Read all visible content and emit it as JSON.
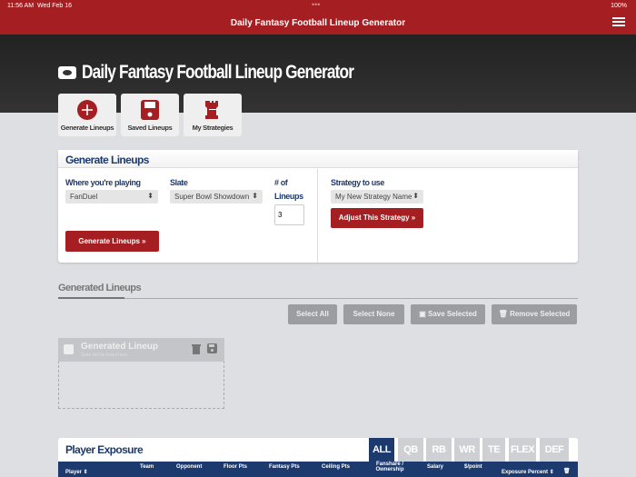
{
  "status": {
    "time": "11:56 AM",
    "date": "Wed Feb 16",
    "battery": "100%"
  },
  "app_title": "Daily Fantasy Football Lineup Generator",
  "hero_title": "Daily Fantasy Football Lineup Generator",
  "nav": [
    {
      "label": "Generate Lineups"
    },
    {
      "label": "Saved Lineups"
    },
    {
      "label": "My Strategies"
    }
  ],
  "generate": {
    "title": "Generate Lineups",
    "where_label": "Where you're playing",
    "where_value": "FanDuel",
    "slate_label": "Slate",
    "slate_value": "Super Bowl Showdown",
    "num_label_1": "# of",
    "num_label_2": "Lineups",
    "num_value": "3",
    "strategy_label": "Strategy to use",
    "strategy_value": "My New Strategy Name",
    "adjust_button": "Adjust This Strategy »",
    "generate_button": "Generate Lineups »"
  },
  "generated": {
    "title": "Generated Lineups",
    "select_all": "Select All",
    "select_none": "Select None",
    "save_selected": "Save Selected",
    "remove_selected": "Remove Selected",
    "card_title": "Generated Lineup",
    "card_subtitle": "Slate will be listed here"
  },
  "exposure": {
    "title": "Player Exposure",
    "tabs": [
      "ALL",
      "QB",
      "RB",
      "WR",
      "TE",
      "FLEX",
      "DEF"
    ],
    "columns": [
      "Player ⇕",
      "Team",
      "Opponent",
      "Floor Pts",
      "Fantasy Pts",
      "Ceiling Pts",
      "Fanshare / Ownership",
      "Salary",
      "$/point",
      "Exposure Percent ⇕"
    ]
  },
  "colors": {
    "red": "#a51e22",
    "navy": "#1c3a6e"
  }
}
